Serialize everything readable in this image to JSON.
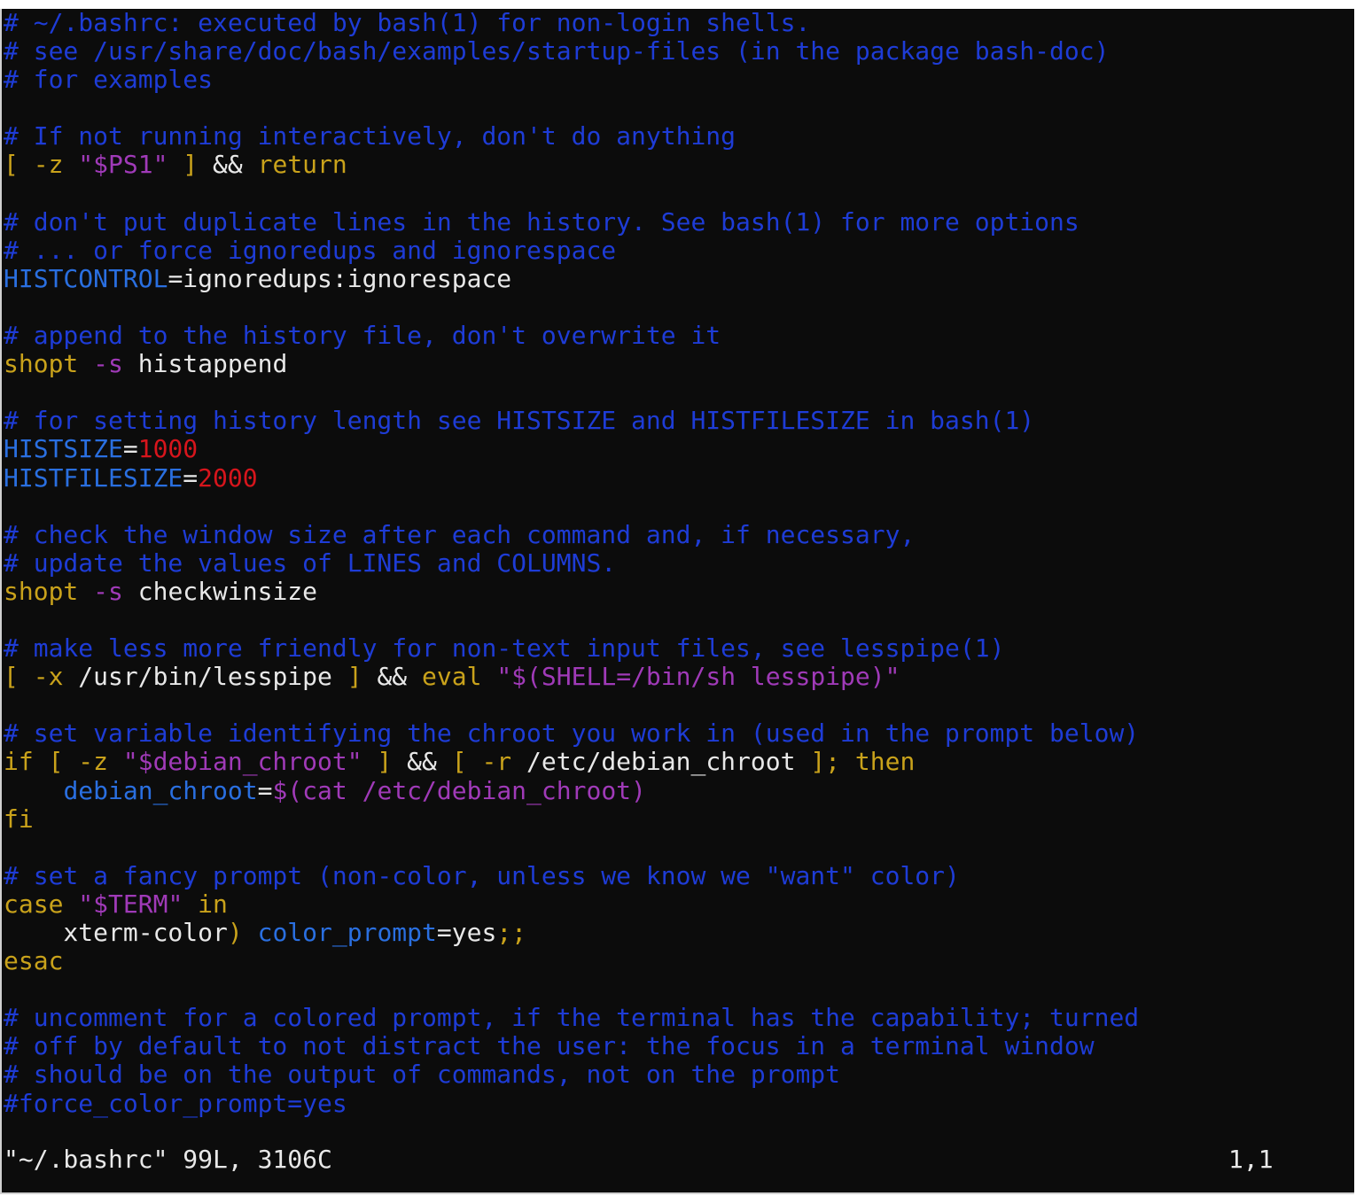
{
  "editor": {
    "colors": {
      "background": "#0c0c0c",
      "comment": "#1e3cd6",
      "keyword": "#c9a21b",
      "string": "#a03ab8",
      "number": "#d7151c",
      "identifier": "#2a6fe0",
      "text": "#e8e8e8"
    },
    "lines": [
      [
        {
          "t": "# ~/.bashrc: executed by bash(1) for non-login shells.",
          "c": "comment"
        }
      ],
      [
        {
          "t": "# see /usr/share/doc/bash/examples/startup-files (in the package bash-doc)",
          "c": "comment"
        }
      ],
      [
        {
          "t": "# for examples",
          "c": "comment"
        }
      ],
      [],
      [
        {
          "t": "# If not running interactively, don't do anything",
          "c": "comment"
        }
      ],
      [
        {
          "t": "[ -z ",
          "c": "keyword"
        },
        {
          "t": "\"$PS1\"",
          "c": "string"
        },
        {
          "t": " ] ",
          "c": "keyword"
        },
        {
          "t": "&& ",
          "c": "text"
        },
        {
          "t": "return",
          "c": "keyword"
        }
      ],
      [],
      [
        {
          "t": "# don't put duplicate lines in the history. See bash(1) for more options",
          "c": "comment"
        }
      ],
      [
        {
          "t": "# ... or force ignoredups and ignorespace",
          "c": "comment"
        }
      ],
      [
        {
          "t": "HISTCONTROL",
          "c": "ident"
        },
        {
          "t": "=ignoredups:ignorespace",
          "c": "text"
        }
      ],
      [],
      [
        {
          "t": "# append to the history file, don't overwrite it",
          "c": "comment"
        }
      ],
      [
        {
          "t": "shopt ",
          "c": "keyword"
        },
        {
          "t": "-s ",
          "c": "string"
        },
        {
          "t": "histappend",
          "c": "text"
        }
      ],
      [],
      [
        {
          "t": "# for setting history length see HISTSIZE and HISTFILESIZE in bash(1)",
          "c": "comment"
        }
      ],
      [
        {
          "t": "HISTSIZE",
          "c": "ident"
        },
        {
          "t": "=",
          "c": "text"
        },
        {
          "t": "1000",
          "c": "number"
        }
      ],
      [
        {
          "t": "HISTFILESIZE",
          "c": "ident"
        },
        {
          "t": "=",
          "c": "text"
        },
        {
          "t": "2000",
          "c": "number"
        }
      ],
      [],
      [
        {
          "t": "# check the window size after each command and, if necessary,",
          "c": "comment"
        }
      ],
      [
        {
          "t": "# update the values of LINES and COLUMNS.",
          "c": "comment"
        }
      ],
      [
        {
          "t": "shopt ",
          "c": "keyword"
        },
        {
          "t": "-s ",
          "c": "string"
        },
        {
          "t": "checkwinsize",
          "c": "text"
        }
      ],
      [],
      [
        {
          "t": "# make less more friendly for non-text input files, see lesspipe(1)",
          "c": "comment"
        }
      ],
      [
        {
          "t": "[ -x ",
          "c": "keyword"
        },
        {
          "t": "/usr/bin/lesspipe ",
          "c": "text"
        },
        {
          "t": "] ",
          "c": "keyword"
        },
        {
          "t": "&& ",
          "c": "text"
        },
        {
          "t": "eval ",
          "c": "keyword"
        },
        {
          "t": "\"$(SHELL=/bin/sh lesspipe)\"",
          "c": "string"
        }
      ],
      [],
      [
        {
          "t": "# set variable identifying the chroot you work in (used in the prompt below)",
          "c": "comment"
        }
      ],
      [
        {
          "t": "if [ -z ",
          "c": "keyword"
        },
        {
          "t": "\"$debian_chroot\"",
          "c": "string"
        },
        {
          "t": " ] ",
          "c": "keyword"
        },
        {
          "t": "&& ",
          "c": "text"
        },
        {
          "t": "[ -r ",
          "c": "keyword"
        },
        {
          "t": "/etc/debian_chroot ",
          "c": "text"
        },
        {
          "t": "]; then",
          "c": "keyword"
        }
      ],
      [
        {
          "t": "    ",
          "c": "text"
        },
        {
          "t": "debian_chroot",
          "c": "ident"
        },
        {
          "t": "=",
          "c": "text"
        },
        {
          "t": "$(cat /etc/debian_chroot)",
          "c": "string"
        }
      ],
      [
        {
          "t": "fi",
          "c": "keyword"
        }
      ],
      [],
      [
        {
          "t": "# set a fancy prompt (non-color, unless we know we \"want\" color)",
          "c": "comment"
        }
      ],
      [
        {
          "t": "case ",
          "c": "keyword"
        },
        {
          "t": "\"$TERM\"",
          "c": "string"
        },
        {
          "t": " in",
          "c": "keyword"
        }
      ],
      [
        {
          "t": "    xterm-color",
          "c": "text"
        },
        {
          "t": ") ",
          "c": "keyword"
        },
        {
          "t": "color_prompt",
          "c": "ident"
        },
        {
          "t": "=yes",
          "c": "text"
        },
        {
          "t": ";;",
          "c": "keyword"
        }
      ],
      [
        {
          "t": "esac",
          "c": "keyword"
        }
      ],
      [],
      [
        {
          "t": "# uncomment for a colored prompt, if the terminal has the capability; turned",
          "c": "comment"
        }
      ],
      [
        {
          "t": "# off by default to not distract the user: the focus in a terminal window",
          "c": "comment"
        }
      ],
      [
        {
          "t": "# should be on the output of commands, not on the prompt",
          "c": "comment"
        }
      ],
      [
        {
          "t": "#force_color_prompt=yes",
          "c": "comment"
        }
      ]
    ]
  },
  "status": {
    "file_info": "\"~/.bashrc\" 99L, 3106C",
    "cursor_position": "1,1"
  }
}
